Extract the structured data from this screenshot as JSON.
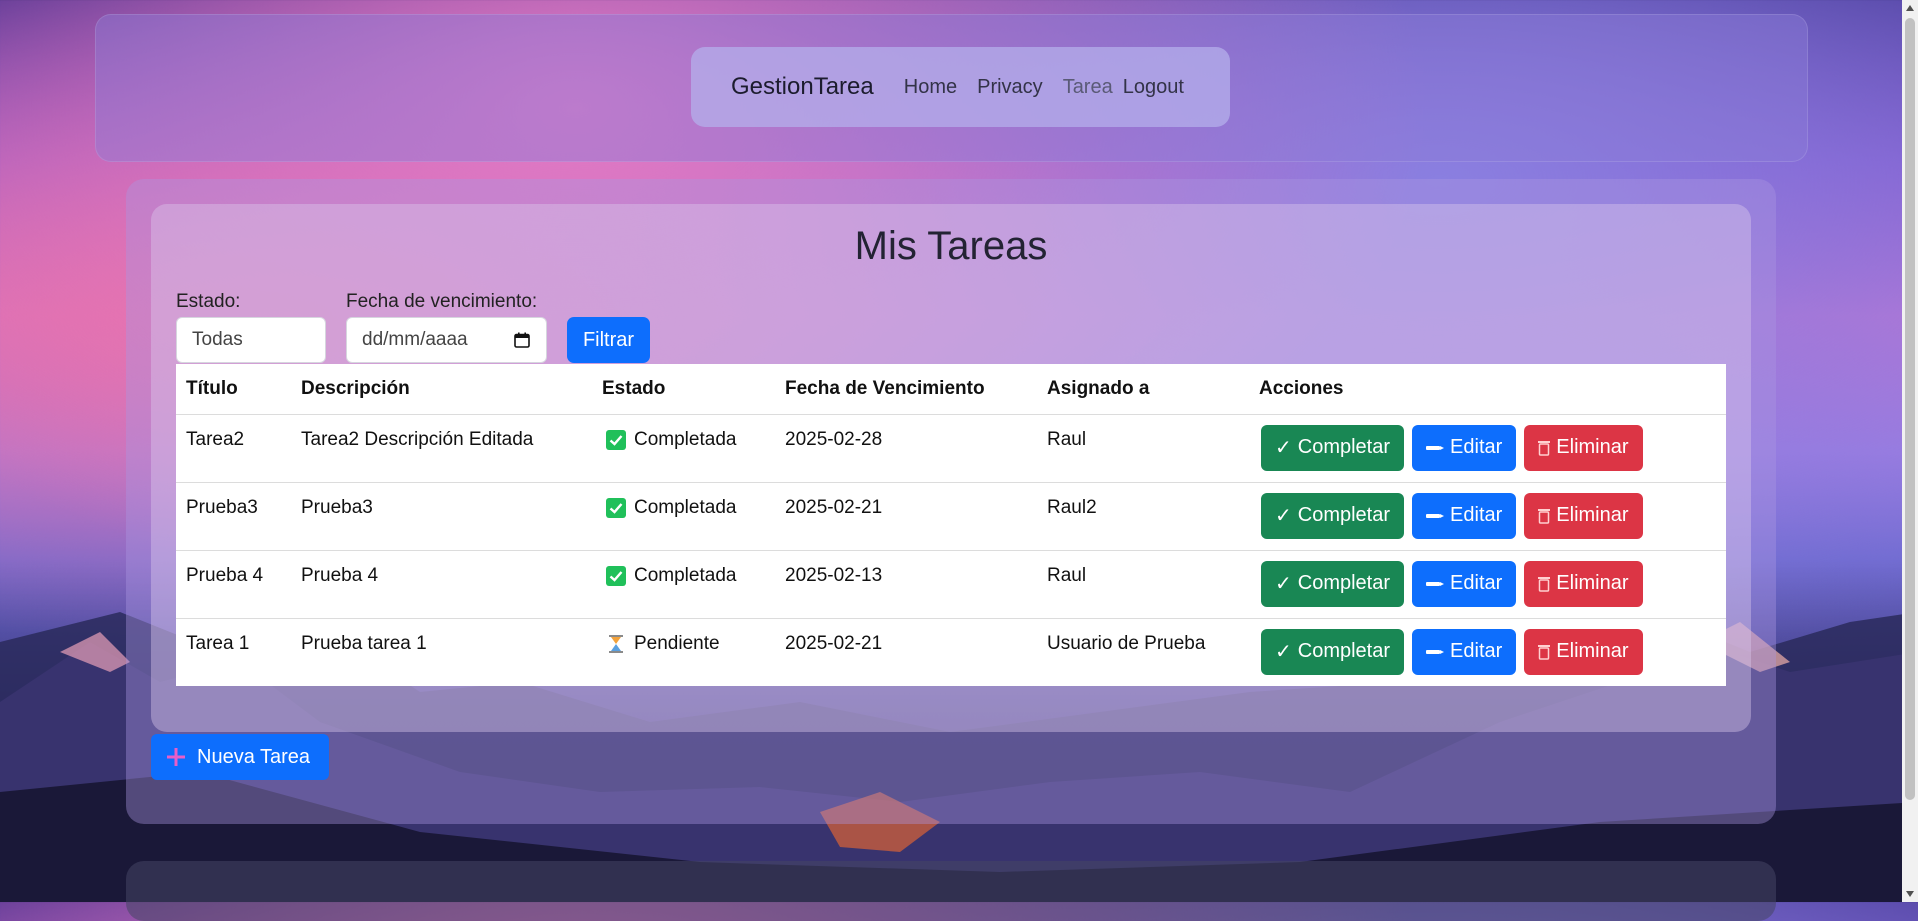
{
  "navbar": {
    "brand": "GestionTarea",
    "links": [
      "Home",
      "Privacy",
      "Tarea",
      "Logout"
    ]
  },
  "page": {
    "title": "Mis Tareas"
  },
  "filters": {
    "estado_label": "Estado:",
    "estado_value": "Todas",
    "fecha_label": "Fecha de vencimiento:",
    "fecha_placeholder": "dd/mm/aaaa",
    "filter_button": "Filtrar"
  },
  "table": {
    "headers": [
      "Título",
      "Descripción",
      "Estado",
      "Fecha de Vencimiento",
      "Asignado a",
      "Acciones"
    ],
    "rows": [
      {
        "titulo": "Tarea2",
        "descripcion": "Tarea2 Descripción Editada",
        "estado": "Completada",
        "estado_icon": "check-box-icon",
        "fecha": "2025-02-28",
        "asignado": "Raul"
      },
      {
        "titulo": "Prueba3",
        "descripcion": "Prueba3",
        "estado": "Completada",
        "estado_icon": "check-box-icon",
        "fecha": "2025-02-21",
        "asignado": "Raul2"
      },
      {
        "titulo": "Prueba 4",
        "descripcion": "Prueba 4",
        "estado": "Completada",
        "estado_icon": "check-box-icon",
        "fecha": "2025-02-13",
        "asignado": "Raul"
      },
      {
        "titulo": "Tarea 1",
        "descripcion": "Prueba tarea 1",
        "estado": "Pendiente",
        "estado_icon": "hourglass-icon",
        "fecha": "2025-02-21",
        "asignado": "Usuario de Prueba"
      }
    ],
    "actions": {
      "complete": "Completar",
      "edit": "Editar",
      "delete": "Eliminar"
    }
  },
  "new_task_button": "Nueva Tarea",
  "colors": {
    "primary": "#0d6efd",
    "success": "#198754",
    "danger": "#dc3545",
    "check": "#20c05a"
  }
}
